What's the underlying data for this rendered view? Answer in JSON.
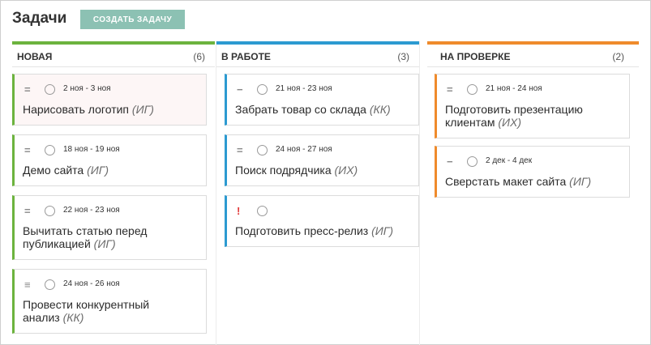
{
  "header": {
    "title": "Задачи",
    "create_button": "СОЗДАТЬ ЗАДАЧУ"
  },
  "colors": {
    "new": "#6cb33e",
    "in_progress": "#2c9ad1",
    "review": "#ef8b2c",
    "button": "#8cc1b3",
    "urgent": "#e23b3b"
  },
  "columns": [
    {
      "title": "НОВАЯ",
      "count": "(6)",
      "cards": [
        {
          "priority": "=",
          "dates": "2 ноя - 3 ноя",
          "title": "Нарисовать логотип",
          "assignee": "(ИГ)"
        },
        {
          "priority": "=",
          "dates": "18 ноя - 19 ноя",
          "title": "Демо сайта",
          "assignee": "(ИГ)"
        },
        {
          "priority": "=",
          "dates": "22 ноя - 23 ноя",
          "title_line1": "Вычитать статью перед",
          "title_line2": "публикацией",
          "assignee": "(ИГ)"
        },
        {
          "priority": "≡",
          "dates": "24 ноя - 26 ноя",
          "title_line1": "Провести конкурентный",
          "title_line2": "анализ",
          "assignee": "(КК)"
        }
      ]
    },
    {
      "title": "В РАБОТЕ",
      "count": "(3)",
      "cards": [
        {
          "priority": "−",
          "dates": "21 ноя - 23 ноя",
          "title": "Забрать товар со склада",
          "assignee": "(КК)"
        },
        {
          "priority": "=",
          "dates": "24 ноя - 27 ноя",
          "title": "Поиск подрядчика",
          "assignee": "(ИХ)"
        },
        {
          "priority": "!",
          "title": "Подготовить пресс-релиз",
          "assignee": "(ИГ)"
        }
      ]
    },
    {
      "title": "НА ПРОВЕРКЕ",
      "count": "(2)",
      "cards": [
        {
          "priority": "=",
          "dates": "21 ноя - 24 ноя",
          "title_line1": "Подготовить презентацию",
          "title_line2": "клиентам",
          "assignee": "(ИХ)"
        },
        {
          "priority": "−",
          "dates": "2 дек - 4 дек",
          "title": "Сверстать макет сайта",
          "assignee": "(ИГ)"
        }
      ]
    }
  ]
}
